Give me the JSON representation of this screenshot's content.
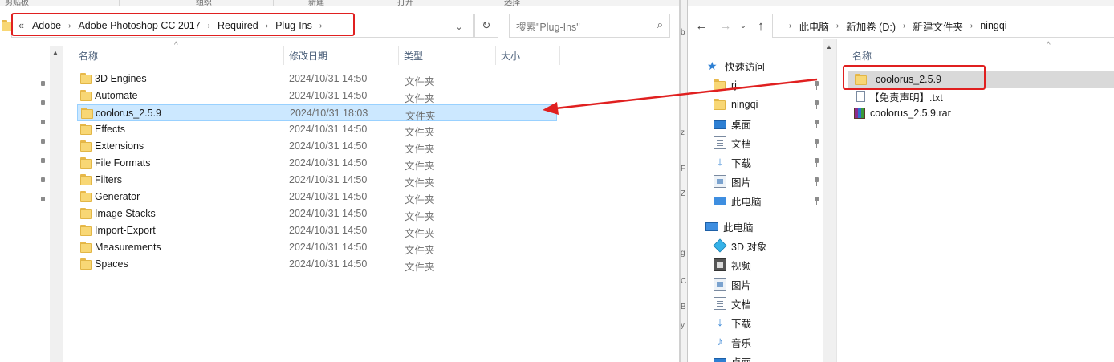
{
  "left_window": {
    "ribbon": [
      "剪贴板",
      "组织",
      "新建",
      "打开",
      "选择"
    ],
    "breadcrumb": [
      "«",
      "Adobe",
      "Adobe Photoshop CC 2017",
      "Required",
      "Plug-Ins"
    ],
    "search_placeholder": "搜索\"Plug-Ins\"",
    "columns": {
      "name": "名称",
      "modified": "修改日期",
      "type": "类型",
      "size": "大小"
    },
    "files": [
      {
        "name": "3D Engines",
        "date": "2024/10/31 14:50",
        "type": "文件夹",
        "selected": false
      },
      {
        "name": "Automate",
        "date": "2024/10/31 14:50",
        "type": "文件夹",
        "selected": false
      },
      {
        "name": "coolorus_2.5.9",
        "date": "2024/10/31 18:03",
        "type": "文件夹",
        "selected": true
      },
      {
        "name": "Effects",
        "date": "2024/10/31 14:50",
        "type": "文件夹",
        "selected": false
      },
      {
        "name": "Extensions",
        "date": "2024/10/31 14:50",
        "type": "文件夹",
        "selected": false
      },
      {
        "name": "File Formats",
        "date": "2024/10/31 14:50",
        "type": "文件夹",
        "selected": false
      },
      {
        "name": "Filters",
        "date": "2024/10/31 14:50",
        "type": "文件夹",
        "selected": false
      },
      {
        "name": "Generator",
        "date": "2024/10/31 14:50",
        "type": "文件夹",
        "selected": false
      },
      {
        "name": "Image Stacks",
        "date": "2024/10/31 14:50",
        "type": "文件夹",
        "selected": false
      },
      {
        "name": "Import-Export",
        "date": "2024/10/31 14:50",
        "type": "文件夹",
        "selected": false
      },
      {
        "name": "Measurements",
        "date": "2024/10/31 14:50",
        "type": "文件夹",
        "selected": false
      },
      {
        "name": "Spaces",
        "date": "2024/10/31 14:50",
        "type": "文件夹",
        "selected": false
      }
    ]
  },
  "right_window": {
    "breadcrumb": [
      "此电脑",
      "新加卷 (D:)",
      "新建文件夹",
      "ningqi"
    ],
    "sidebar": {
      "quick_access": "快速访问",
      "quick_items": [
        "rj",
        "ningqi",
        "桌面",
        "文档",
        "下载",
        "图片",
        "此电脑"
      ],
      "this_pc": "此电脑",
      "pc_items": [
        "3D 对象",
        "视频",
        "图片",
        "文档",
        "下载",
        "音乐",
        "桌面"
      ]
    },
    "column_name": "名称",
    "files": [
      {
        "name": "coolorus_2.5.9",
        "kind": "folder"
      },
      {
        "name": "【免责声明】.txt",
        "kind": "txt"
      },
      {
        "name": "coolorus_2.5.9.rar",
        "kind": "rar"
      }
    ]
  },
  "colors": {
    "annotation": "#e02020",
    "selection": "#cce8ff",
    "folder": "#f8d775"
  }
}
